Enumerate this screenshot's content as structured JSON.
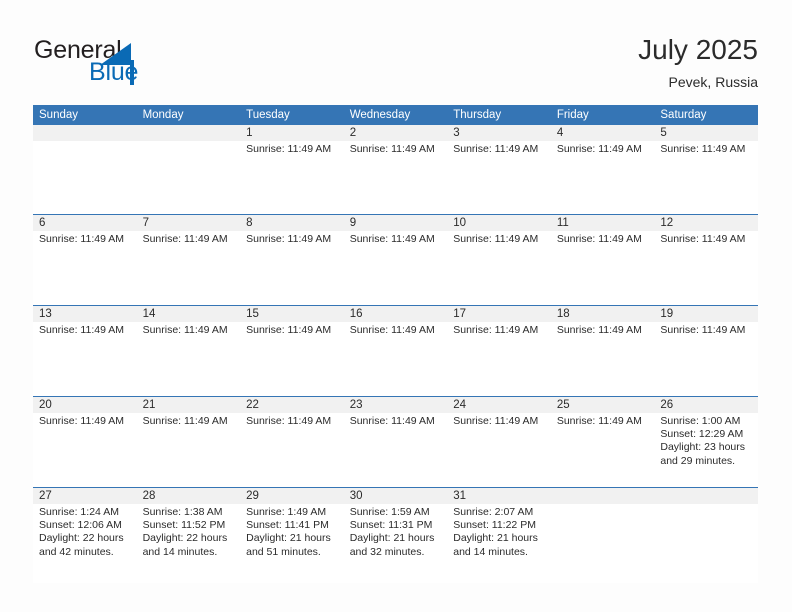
{
  "brand": {
    "name_part1": "General",
    "name_part2": "Blue",
    "triangle_icon": "triangle-icon"
  },
  "header": {
    "title": "July 2025",
    "subtitle": "Pevek, Russia"
  },
  "colors": {
    "header_blue": "#3575b5",
    "brand_blue": "#0a6ab5",
    "day_band": "#f1f1f1",
    "page_background": "#fdfdfd",
    "text": "#2b2b2b"
  },
  "calendar": {
    "weekday_headers": [
      "Sunday",
      "Monday",
      "Tuesday",
      "Wednesday",
      "Thursday",
      "Friday",
      "Saturday"
    ],
    "weeks": [
      [
        {
          "date": "",
          "lines": []
        },
        {
          "date": "",
          "lines": []
        },
        {
          "date": "1",
          "lines": [
            "Sunrise: 11:49 AM"
          ]
        },
        {
          "date": "2",
          "lines": [
            "Sunrise: 11:49 AM"
          ]
        },
        {
          "date": "3",
          "lines": [
            "Sunrise: 11:49 AM"
          ]
        },
        {
          "date": "4",
          "lines": [
            "Sunrise: 11:49 AM"
          ]
        },
        {
          "date": "5",
          "lines": [
            "Sunrise: 11:49 AM"
          ]
        }
      ],
      [
        {
          "date": "6",
          "lines": [
            "Sunrise: 11:49 AM"
          ]
        },
        {
          "date": "7",
          "lines": [
            "Sunrise: 11:49 AM"
          ]
        },
        {
          "date": "8",
          "lines": [
            "Sunrise: 11:49 AM"
          ]
        },
        {
          "date": "9",
          "lines": [
            "Sunrise: 11:49 AM"
          ]
        },
        {
          "date": "10",
          "lines": [
            "Sunrise: 11:49 AM"
          ]
        },
        {
          "date": "11",
          "lines": [
            "Sunrise: 11:49 AM"
          ]
        },
        {
          "date": "12",
          "lines": [
            "Sunrise: 11:49 AM"
          ]
        }
      ],
      [
        {
          "date": "13",
          "lines": [
            "Sunrise: 11:49 AM"
          ]
        },
        {
          "date": "14",
          "lines": [
            "Sunrise: 11:49 AM"
          ]
        },
        {
          "date": "15",
          "lines": [
            "Sunrise: 11:49 AM"
          ]
        },
        {
          "date": "16",
          "lines": [
            "Sunrise: 11:49 AM"
          ]
        },
        {
          "date": "17",
          "lines": [
            "Sunrise: 11:49 AM"
          ]
        },
        {
          "date": "18",
          "lines": [
            "Sunrise: 11:49 AM"
          ]
        },
        {
          "date": "19",
          "lines": [
            "Sunrise: 11:49 AM"
          ]
        }
      ],
      [
        {
          "date": "20",
          "lines": [
            "Sunrise: 11:49 AM"
          ]
        },
        {
          "date": "21",
          "lines": [
            "Sunrise: 11:49 AM"
          ]
        },
        {
          "date": "22",
          "lines": [
            "Sunrise: 11:49 AM"
          ]
        },
        {
          "date": "23",
          "lines": [
            "Sunrise: 11:49 AM"
          ]
        },
        {
          "date": "24",
          "lines": [
            "Sunrise: 11:49 AM"
          ]
        },
        {
          "date": "25",
          "lines": [
            "Sunrise: 11:49 AM"
          ]
        },
        {
          "date": "26",
          "lines": [
            "Sunrise: 1:00 AM",
            "Sunset: 12:29 AM",
            "Daylight: 23 hours and 29 minutes."
          ]
        }
      ],
      [
        {
          "date": "27",
          "lines": [
            "Sunrise: 1:24 AM",
            "Sunset: 12:06 AM",
            "Daylight: 22 hours and 42 minutes."
          ]
        },
        {
          "date": "28",
          "lines": [
            "Sunrise: 1:38 AM",
            "Sunset: 11:52 PM",
            "Daylight: 22 hours and 14 minutes."
          ]
        },
        {
          "date": "29",
          "lines": [
            "Sunrise: 1:49 AM",
            "Sunset: 11:41 PM",
            "Daylight: 21 hours and 51 minutes."
          ]
        },
        {
          "date": "30",
          "lines": [
            "Sunrise: 1:59 AM",
            "Sunset: 11:31 PM",
            "Daylight: 21 hours and 32 minutes."
          ]
        },
        {
          "date": "31",
          "lines": [
            "Sunrise: 2:07 AM",
            "Sunset: 11:22 PM",
            "Daylight: 21 hours and 14 minutes."
          ]
        },
        {
          "date": "",
          "lines": []
        },
        {
          "date": "",
          "lines": []
        }
      ]
    ]
  }
}
